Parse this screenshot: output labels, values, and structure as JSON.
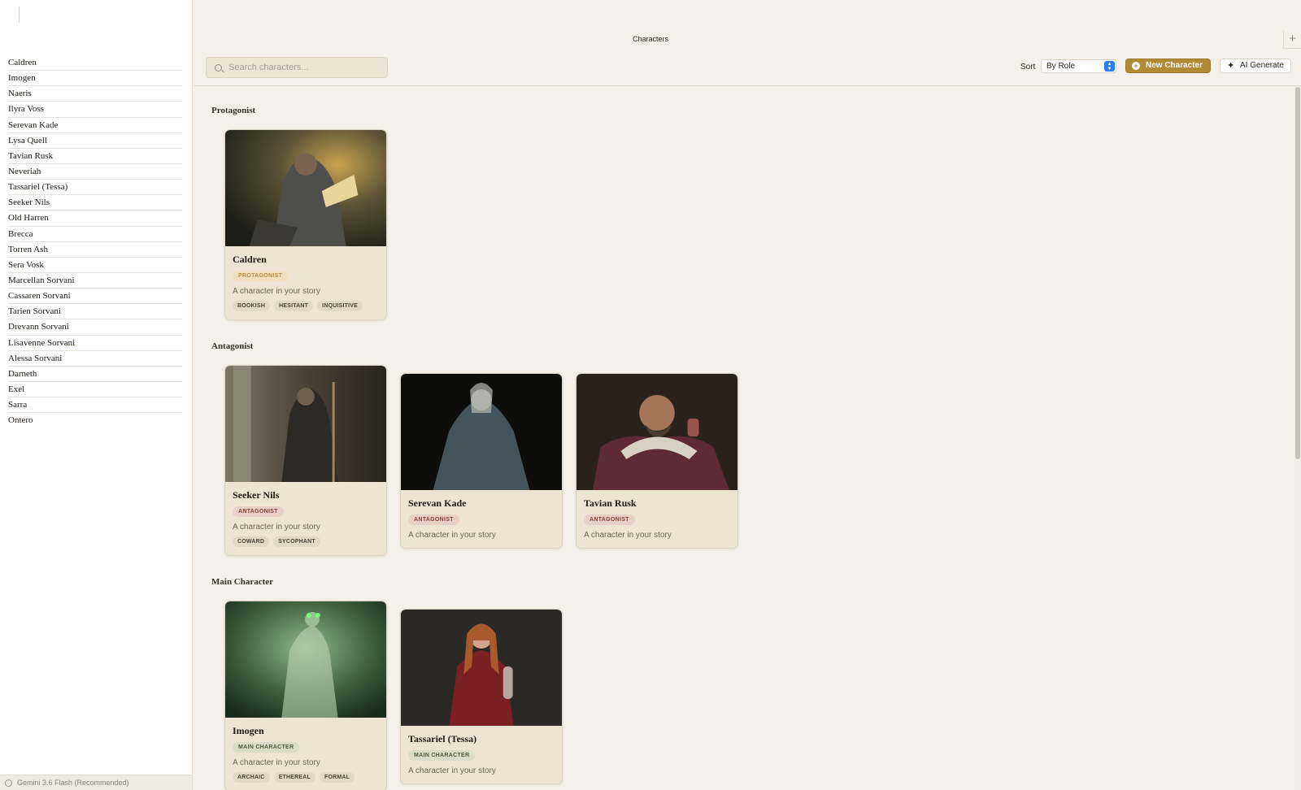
{
  "sidebar": {
    "characters": [
      "Caldren",
      "Imogen",
      "Naeris",
      "Ilyra Voss",
      "Serevan Kade",
      "Lysa Quell",
      "Tavian Rusk",
      "Neveriah",
      "Tassariel (Tessa)",
      "Seeker Nils",
      "Old Harren",
      "Brecca",
      "Torren Ash",
      "Sera Vosk",
      "Marcellan Sorvani",
      "Cassaren Sorvani",
      "Tarien Sorvani",
      "Drevann Sorvani",
      "Lisavenne Sorvani",
      "Alessa Sorvani",
      "Darneth",
      "Exel",
      "Sarra",
      "Ontero"
    ],
    "footer_model": "Gemini 3.6 Flash (Recommended)"
  },
  "header": {
    "title": "Characters",
    "plus_label": "+"
  },
  "toolbar": {
    "search_placeholder": "Search characters...",
    "sort_label": "Sort",
    "sort_value": "By Role",
    "new_label": "New Character",
    "ai_label": "AI Generate"
  },
  "sections": {
    "protagonist": "Protagonist",
    "antagonist": "Antagonist",
    "main": "Main Character"
  },
  "cards": {
    "caldren": {
      "name": "Caldren",
      "role": "PROTAGONIST",
      "desc": "A character in your story",
      "traits": [
        "BOOKISH",
        "HESITANT",
        "INQUISITIVE"
      ]
    },
    "seeker": {
      "name": "Seeker Nils",
      "role": "ANTAGONIST",
      "desc": "A character in your story",
      "traits": [
        "COWARD",
        "SYCOPHANT"
      ]
    },
    "serevan": {
      "name": "Serevan Kade",
      "role": "ANTAGONIST",
      "desc": "A character in your story"
    },
    "tavian": {
      "name": "Tavian Rusk",
      "role": "ANTAGONIST",
      "desc": "A character in your story"
    },
    "imogen": {
      "name": "Imogen",
      "role": "MAIN CHARACTER",
      "desc": "A character in your story",
      "traits": [
        "ARCHAIC",
        "ETHEREAL",
        "FORMAL"
      ]
    },
    "tessa": {
      "name": "Tassariel (Tessa)",
      "role": "MAIN CHARACTER",
      "desc": "A character in your story"
    }
  },
  "colors": {
    "accent": "#b08a34",
    "background": "#f5f1ea",
    "card": "#ede4d4",
    "sort_caret": "#2b7de9"
  }
}
